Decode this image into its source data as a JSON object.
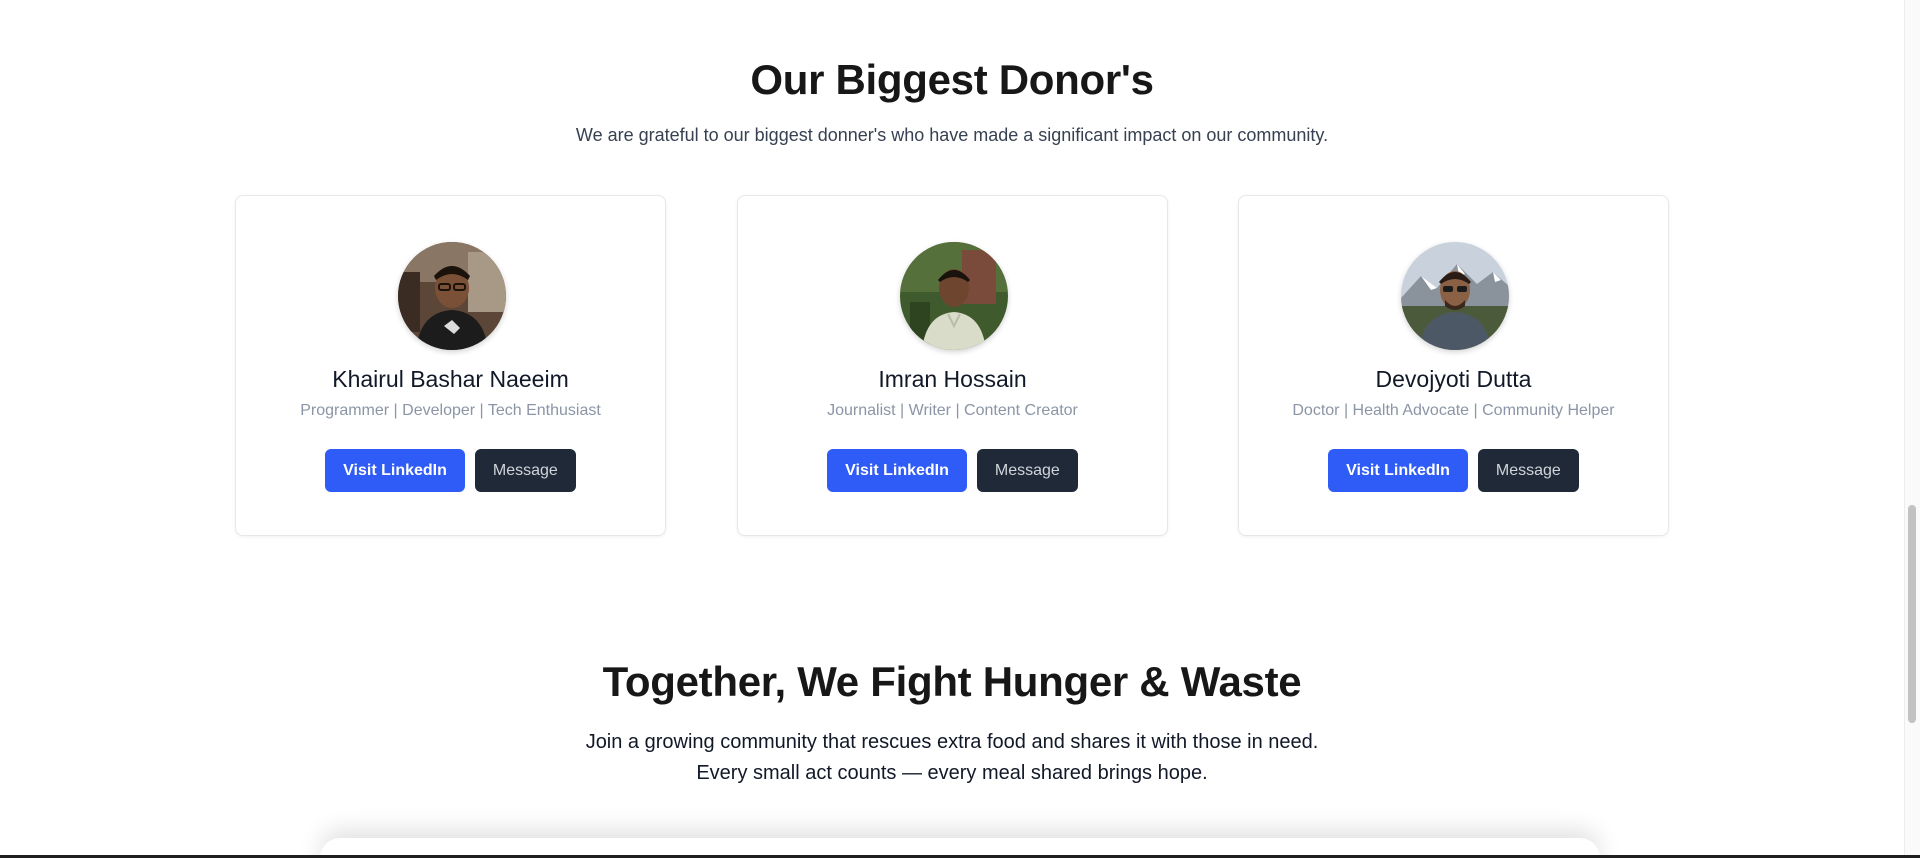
{
  "donors_section": {
    "title": "Our Biggest Donor's",
    "subtitle": "We are grateful to our biggest donner's who have made a significant impact on our community.",
    "donors": [
      {
        "name": "Khairul Bashar Naeeim",
        "role": "Programmer | Developer | Tech Enthusiast",
        "linkedin_label": "Visit LinkedIn",
        "message_label": "Message"
      },
      {
        "name": "Imran Hossain",
        "role": "Journalist | Writer | Content Creator",
        "linkedin_label": "Visit LinkedIn",
        "message_label": "Message"
      },
      {
        "name": "Devojyoti Dutta",
        "role": "Doctor | Health Advocate | Community Helper",
        "linkedin_label": "Visit LinkedIn",
        "message_label": "Message"
      }
    ]
  },
  "community_section": {
    "title": "Together, We Fight Hunger & Waste",
    "line1": "Join a growing community that rescues extra food and shares it with those in need.",
    "line2": "Every small act counts — every meal shared brings hope."
  },
  "colors": {
    "primary_button": "#2f5bf7",
    "secondary_button": "#1f2937",
    "heading": "#171717",
    "muted_text": "#8b95a5"
  }
}
